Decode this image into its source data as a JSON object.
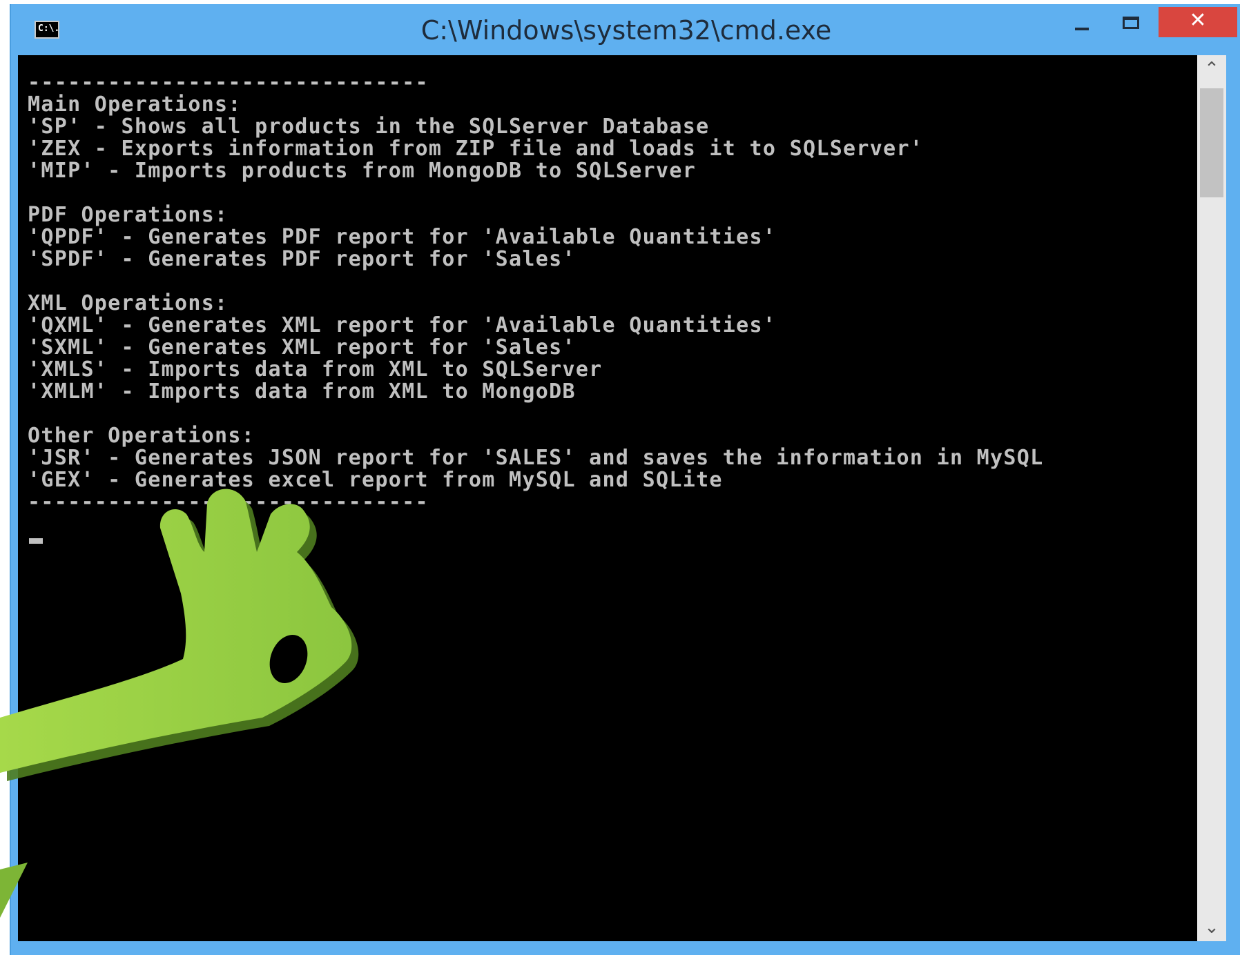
{
  "window": {
    "title": "C:\\Windows\\system32\\cmd.exe",
    "icon_text": "C:\\.",
    "minimize_glyph": "",
    "close_glyph": "✕"
  },
  "console": {
    "lines": [
      "------------------------------",
      "Main Operations:",
      "'SP' - Shows all products in the SQLServer Database",
      "'ZEX - Exports information from ZIP file and loads it to SQLServer'",
      "'MIP' - Imports products from MongoDB to SQLServer",
      "",
      "PDF Operations:",
      "'QPDF' - Generates PDF report for 'Available Quantities'",
      "'SPDF' - Generates PDF report for 'Sales'",
      "",
      "XML Operations:",
      "'QXML' - Generates XML report for 'Available Quantities'",
      "'SXML' - Generates XML report for 'Sales'",
      "'XMLS' - Imports data from XML to SQLServer",
      "'XMLM' - Imports data from XML to MongoDB",
      "",
      "Other Operations:",
      "'JSR' - Generates JSON report for 'SALES' and saves the information in MySQL",
      "'GEX' - Generates excel report from MySQL and SQLite",
      "------------------------------"
    ],
    "text_color": "#c0c0c0",
    "background": "#000000"
  },
  "scrollbar": {
    "up_glyph": "⌃",
    "down_glyph": "⌄"
  },
  "overlay": {
    "icon": "ok-hand-gesture",
    "color": "#8dc63f"
  }
}
